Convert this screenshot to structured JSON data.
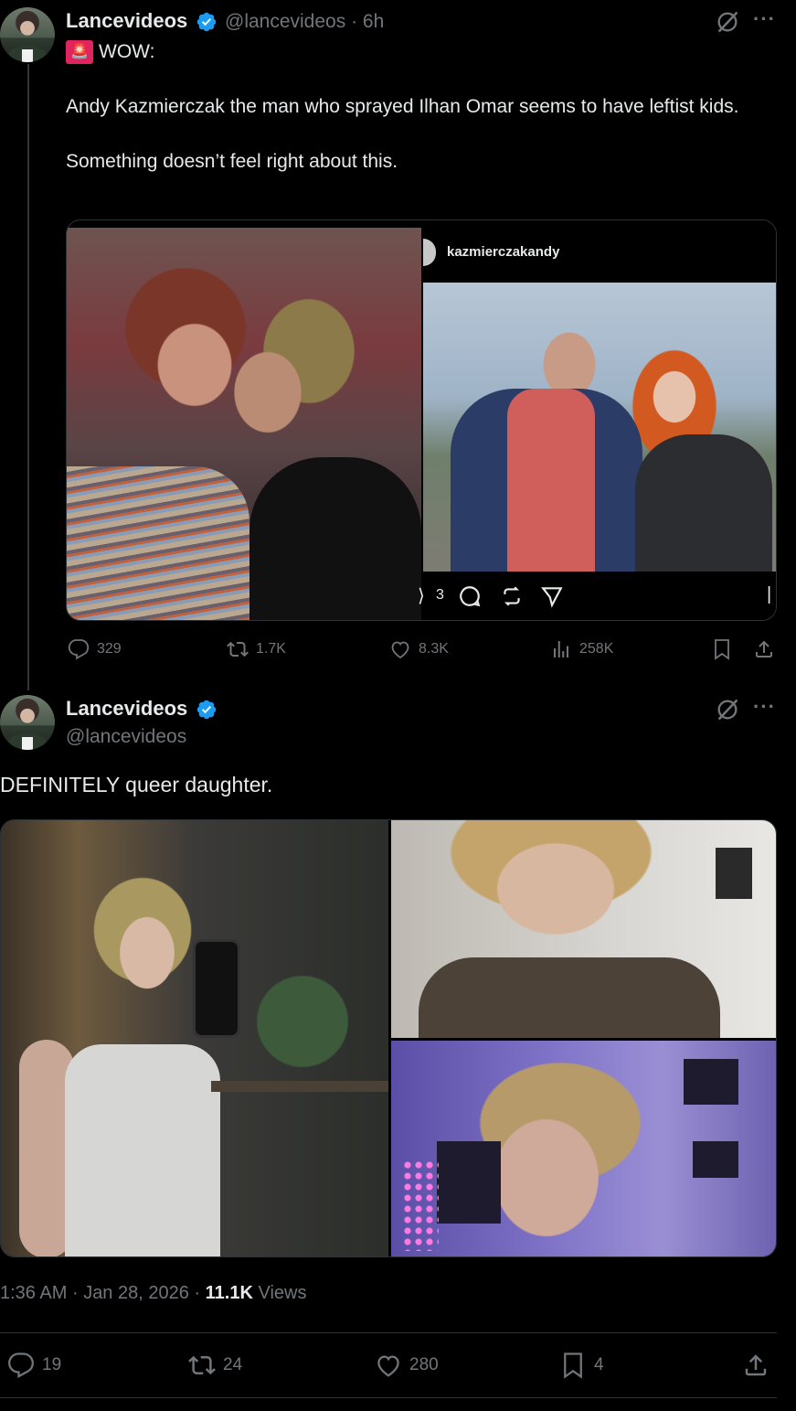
{
  "tweet1": {
    "name": "Lancevideos",
    "handle": "@lancevideos",
    "time_sep": "·",
    "time": "6h",
    "alert_emoji": "🚨",
    "line1": "WOW:",
    "line2": "Andy Kazmierczak the man who sprayed Ilhan Omar seems to have leftist kids.",
    "line3": "Something doesn’t feel right about this.",
    "ig_username": "kazmierczakandy",
    "ig_count": "3",
    "stats": {
      "replies": "329",
      "reposts": "1.7K",
      "likes": "8.3K",
      "views": "258K"
    }
  },
  "tweet2": {
    "name": "Lancevideos",
    "handle": "@lancevideos",
    "text": "DEFINITELY queer daughter.",
    "time": "1:36 AM",
    "sep1": "·",
    "date": "Jan 28, 2026",
    "sep2": "·",
    "views_count": "11.1K",
    "views_label": "Views",
    "stats": {
      "replies": "19",
      "reposts": "24",
      "likes": "280",
      "bookmarks": "4"
    }
  },
  "icons": {
    "verified": "verified-badge-icon",
    "grok": "grok-icon",
    "more": "more-icon",
    "reply": "reply-icon",
    "repost": "repost-icon",
    "like": "like-icon",
    "views": "views-icon",
    "bookmark": "bookmark-icon",
    "share": "share-icon"
  },
  "colors": {
    "background": "#000000",
    "text": "#e7e9ea",
    "muted": "#71767b",
    "verified": "#1d9bf0",
    "border": "#2f3336"
  }
}
